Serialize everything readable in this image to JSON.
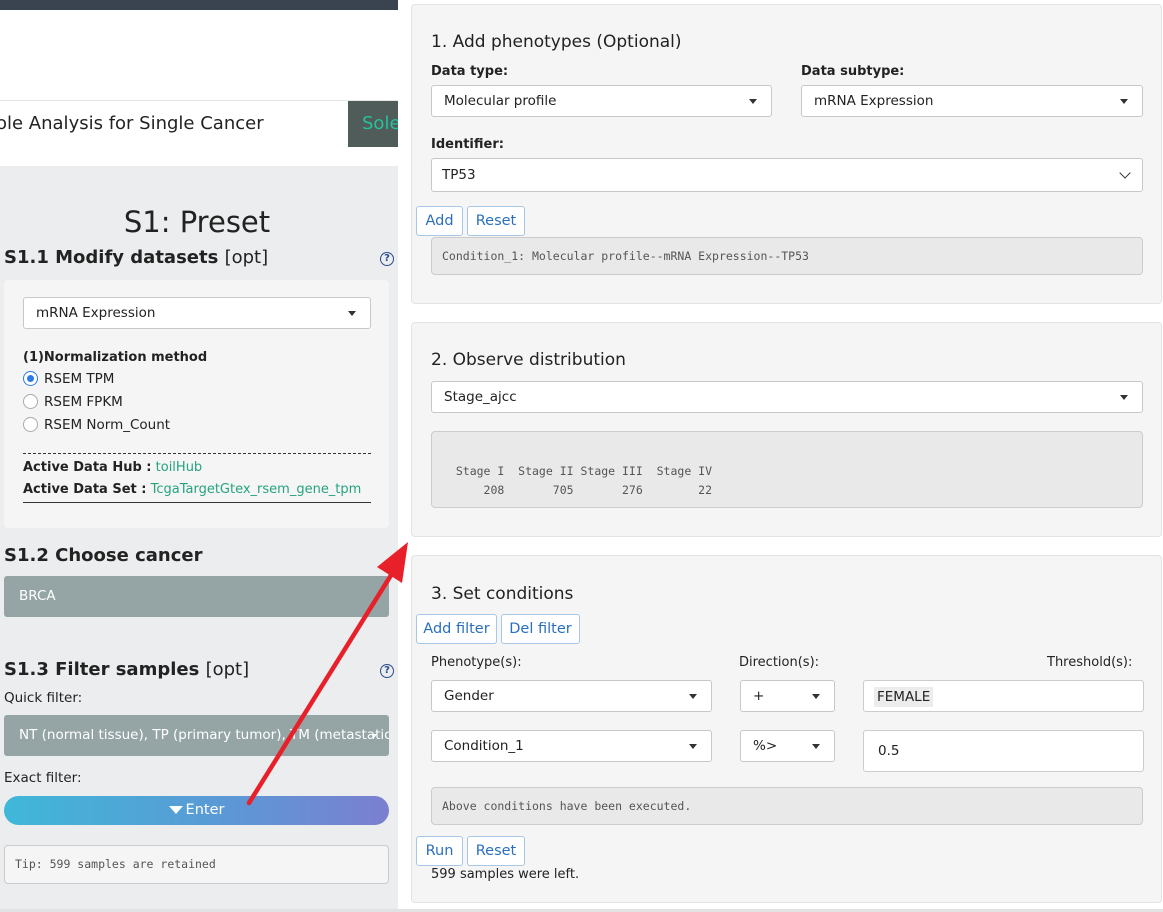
{
  "header": {
    "tab_title": "ole Analysis for Single Cancer",
    "tab_button": "Sole"
  },
  "left": {
    "preset_title": "S1: Preset",
    "s11": {
      "title": "S1.1 Modify datasets",
      "opt": "[opt]",
      "help": "?"
    },
    "dataset_select": "mRNA Expression",
    "normalization_label": "(1)Normalization method",
    "radios": [
      {
        "label": "RSEM TPM",
        "checked": true
      },
      {
        "label": "RSEM FPKM",
        "checked": false
      },
      {
        "label": "RSEM Norm_Count",
        "checked": false
      }
    ],
    "active_hub_label": "Active Data Hub :",
    "active_hub_value": "toilHub",
    "active_set_label": "Active Data Set :",
    "active_set_value": "TcgaTargetGtex_rsem_gene_tpm",
    "s12": {
      "title": "S1.2 Choose cancer"
    },
    "cancer_value": "BRCA",
    "s13": {
      "title": "S1.3 Filter samples",
      "opt": "[opt]",
      "help": "?"
    },
    "quick_filter_label": "Quick filter:",
    "quick_filter_value": "NT (normal tissue), TP (primary tumor), TM (metastatic t",
    "exact_filter_label": "Exact filter:",
    "enter_label": "Enter",
    "tip": "Tip: 599 samples are retained"
  },
  "card1": {
    "title": "1. Add phenotypes (Optional)",
    "data_type_label": "Data type:",
    "data_type_value": "Molecular profile",
    "data_subtype_label": "Data subtype:",
    "data_subtype_value": "mRNA Expression",
    "identifier_label": "Identifier:",
    "identifier_value": "TP53",
    "add_label": "Add",
    "reset_label": "Reset",
    "output": "Condition_1: Molecular profile--mRNA Expression--TP53"
  },
  "card2": {
    "title": "2. Observe distribution",
    "select_value": "Stage_ajcc",
    "output_header": "  Stage I  Stage II Stage III  Stage IV",
    "output_values": "      208       705       276        22"
  },
  "card3": {
    "title": "3. Set conditions",
    "add_filter_label": "Add filter",
    "del_filter_label": "Del filter",
    "phenotype_label": "Phenotype(s):",
    "direction_label": "Direction(s):",
    "threshold_label": "Threshold(s):",
    "rows": [
      {
        "phenotype": "Gender",
        "direction": "+",
        "threshold": "FEMALE"
      },
      {
        "phenotype": "Condition_1",
        "direction": "%>",
        "threshold": "0.5"
      }
    ],
    "output": "Above conditions have been executed.",
    "run_label": "Run",
    "reset_label": "Reset",
    "samples_left": "599 samples were left."
  },
  "colors": {
    "accent_link": "#25a37f",
    "gray_panel": "#95a5a6",
    "arrow": "#e8202a",
    "button_text": "#2a6fbf"
  },
  "icons": [
    "help-icon",
    "caret-down-icon",
    "chevron-down-icon",
    "filter-icon",
    "arrow-annotation"
  ]
}
